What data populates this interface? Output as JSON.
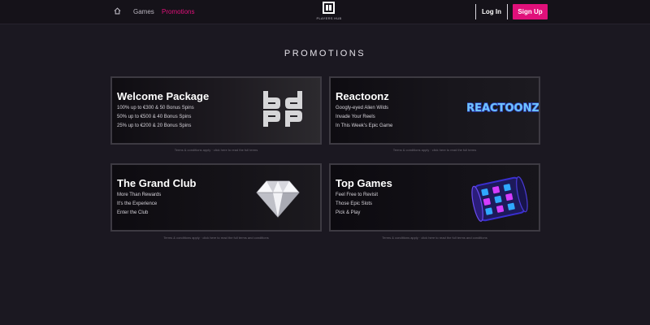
{
  "header": {
    "nav": {
      "games": "Games",
      "promotions": "Promotions"
    },
    "logo_text": "PLAYERS HUB",
    "login_label": "Log In",
    "signup_label": "Sign Up",
    "accent_color": "#e0107a"
  },
  "page_title": "PROMOTIONS",
  "cards": [
    {
      "title": "Welcome Package",
      "lines": [
        "100% up to €300 & 50 Bonus Spins",
        "50% up to €500 & 40 Bonus Spins",
        "25% up to €200 & 20 Bonus Spins"
      ],
      "art": "bd-logo",
      "caption": "Terms & conditions apply · click here to read the full terms"
    },
    {
      "title": "Reactoonz",
      "lines": [
        "Googly-eyed Alien Wilds",
        "Invade Your Reels",
        "In This Week's Epic Game"
      ],
      "art": "reactoonz-logo",
      "art_text": "REACTOONZ",
      "caption": "Terms & conditions apply · click here to read the full terms"
    },
    {
      "title": "The Grand Club",
      "lines": [
        "More Than Rewards",
        "It's the Experience",
        "Enter the Club"
      ],
      "art": "diamond-icon",
      "caption": "Terms & conditions apply · click here to read the full terms and conditions"
    },
    {
      "title": "Top Games",
      "lines": [
        "Feel Free to Revisit",
        "Those Epic Slots",
        "Pick & Play"
      ],
      "art": "slot-reel-icon",
      "caption": "Terms & conditions apply · click here to read the full terms and conditions"
    }
  ]
}
